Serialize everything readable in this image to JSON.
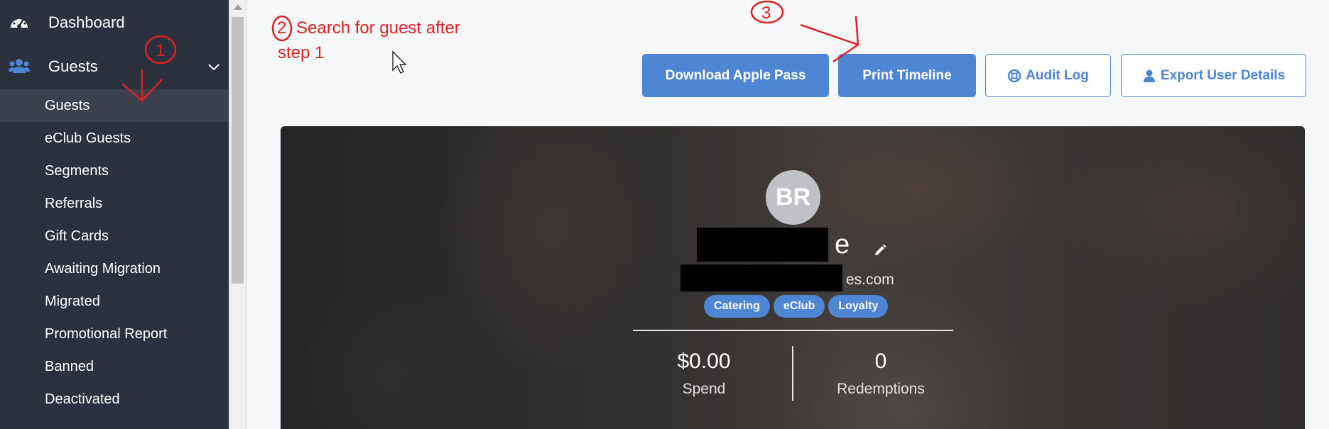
{
  "sidebar": {
    "top_items": [
      {
        "label": "Dashboard",
        "icon": "dashboard-gauge-icon"
      },
      {
        "label": "Guests",
        "icon": "users-icon",
        "expanded": true
      }
    ],
    "sub_items": [
      {
        "label": "Guests",
        "active": true
      },
      {
        "label": "eClub Guests"
      },
      {
        "label": "Segments"
      },
      {
        "label": "Referrals"
      },
      {
        "label": "Gift Cards"
      },
      {
        "label": "Awaiting Migration"
      },
      {
        "label": "Migrated"
      },
      {
        "label": "Promotional Report"
      },
      {
        "label": "Banned"
      },
      {
        "label": "Deactivated"
      }
    ]
  },
  "actions": {
    "download_apple_pass": "Download Apple Pass",
    "print_timeline": "Print Timeline",
    "audit_log": "Audit Log",
    "export_user_details": "Export User Details"
  },
  "profile": {
    "initials": "BR",
    "name_visible_tail": "e",
    "email_visible_tail": "es.com",
    "tags": [
      "Catering",
      "eClub",
      "Loyalty"
    ],
    "stats": [
      {
        "value": "$0.00",
        "label": "Spend"
      },
      {
        "value": "0",
        "label": "Redemptions"
      }
    ]
  },
  "annotations": {
    "step1": "1",
    "step2_number": "2",
    "step2_text_line1": "Search for guest after",
    "step2_text_line2": "step 1",
    "step3": "3"
  },
  "colors": {
    "sidebar_bg": "#2b313d",
    "sidebar_active": "#3c424d",
    "accent": "#4f86d4",
    "annotation_red": "#e02020",
    "icon_blue": "#4f86d4"
  }
}
